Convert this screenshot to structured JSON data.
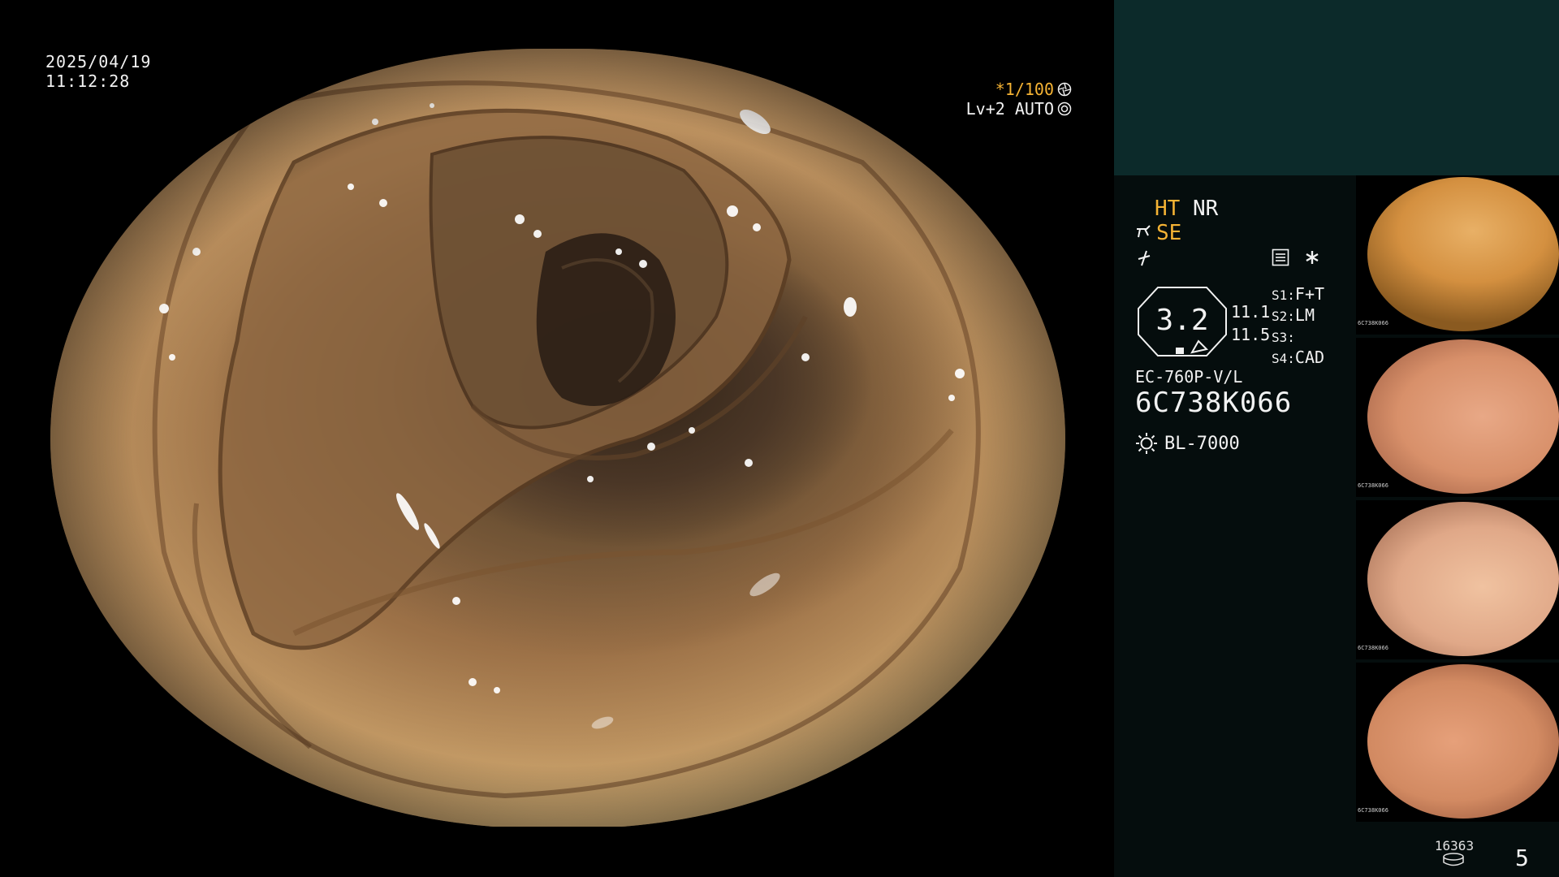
{
  "overlay": {
    "date": "2025/04/19",
    "time": "11:12:28",
    "shutter": "*1/100",
    "iris": "Lv+2 AUTO"
  },
  "settings": {
    "ht": "HT",
    "nr": "NR",
    "se": "SE",
    "octagon_value": "3.2",
    "ratio_1": "11.1",
    "ratio_2": "11.5",
    "scenes": [
      {
        "key": "S1:",
        "value": "F+T"
      },
      {
        "key": "S2:",
        "value": "LM"
      },
      {
        "key": "S3:",
        "value": ""
      },
      {
        "key": "S4:",
        "value": "CAD"
      }
    ],
    "scope_model": "EC-760P-V/L",
    "scope_serial": "6C738K066",
    "light_source": "BL-7000"
  },
  "thumbnails": [
    {
      "caption": "6C738K066"
    },
    {
      "caption": "6C738K066"
    },
    {
      "caption": "6C738K066"
    },
    {
      "caption": "6C738K066"
    }
  ],
  "counter": {
    "remaining": "16363",
    "count": "5"
  },
  "icons": {
    "shutter": "aperture-icon",
    "iris": "iris-icon",
    "scope": "scope-icon",
    "freeze": "freeze-icon",
    "menu": "settings-list-icon",
    "star": "asterisk-icon",
    "light": "lamp-icon",
    "storage": "storage-icon"
  },
  "colors": {
    "accent": "#f5b334",
    "panel": "#050d0d",
    "top_box": "#0c2a2a"
  }
}
